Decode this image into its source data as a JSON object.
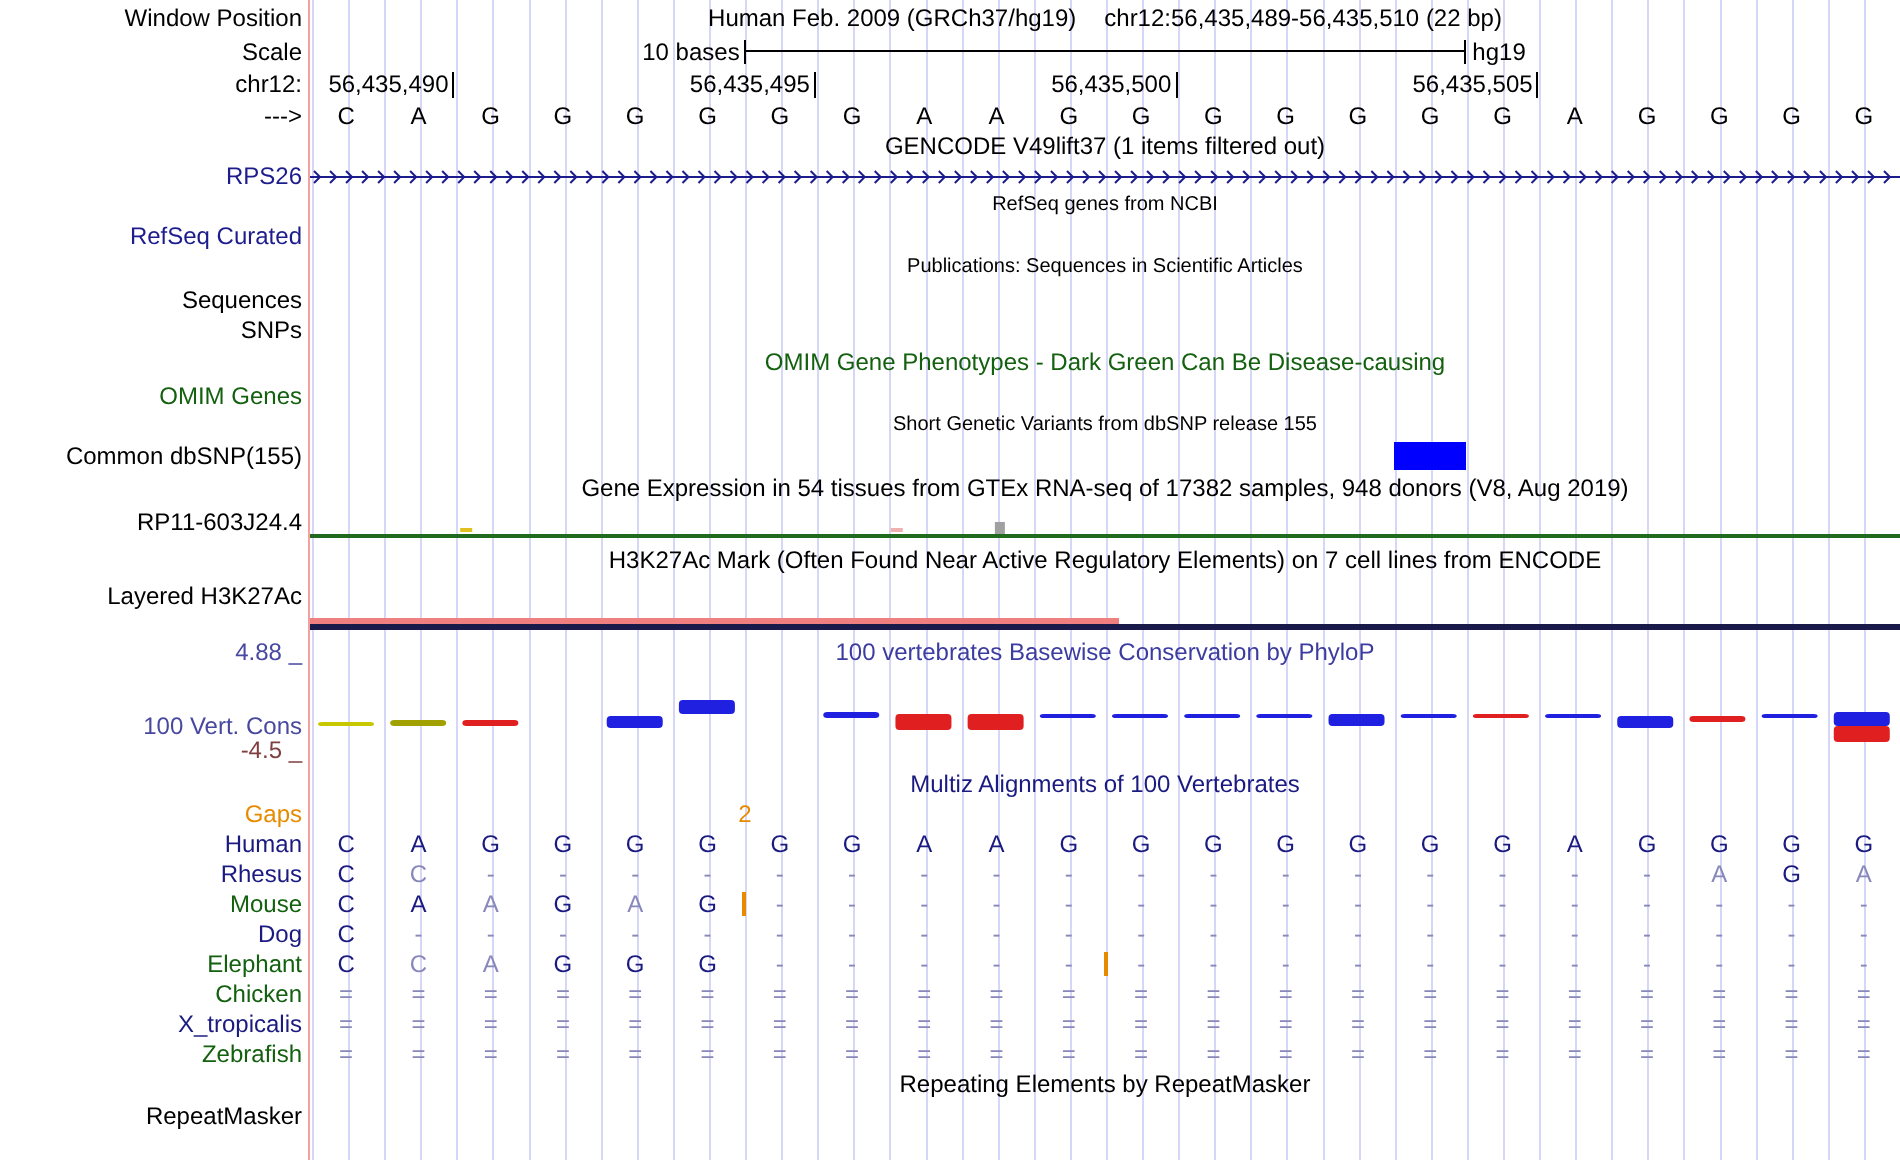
{
  "position": {
    "label": "Window Position",
    "assembly": "Human Feb. 2009 (GRCh37/hg19)",
    "range": "chr12:56,435,489-56,435,510 (22 bp)"
  },
  "scale": {
    "label": "Scale",
    "length": "10 bases",
    "build": "hg19"
  },
  "ruler": {
    "label": "chr12:",
    "ticks": [
      "56,435,490",
      "56,435,495",
      "56,435,500",
      "56,435,505"
    ]
  },
  "sequence": {
    "label": "--->",
    "bases": [
      "C",
      "A",
      "G",
      "G",
      "G",
      "G",
      "G",
      "G",
      "A",
      "A",
      "G",
      "G",
      "G",
      "G",
      "G",
      "G",
      "G",
      "A",
      "G",
      "G",
      "G",
      "G"
    ]
  },
  "gencode": {
    "title": "GENCODE V49lift37 (1 items filtered out)",
    "gene": "RPS26"
  },
  "refseq": {
    "title": "RefSeq genes from NCBI",
    "label": "RefSeq Curated"
  },
  "publications": {
    "title": "Publications: Sequences in Scientific Articles",
    "labels": [
      "Sequences",
      "SNPs"
    ]
  },
  "omim": {
    "title": "OMIM Gene Phenotypes - Dark Green Can Be Disease-causing",
    "label": "OMIM Genes"
  },
  "dbsnp": {
    "title": "Short Genetic Variants from dbSNP release 155",
    "label": "Common dbSNP(155)"
  },
  "gtex": {
    "title": "Gene Expression in 54 tissues from GTEx RNA-seq of 17382 samples, 948 donors (V8, Aug 2019)",
    "gene": "RP11-603J24.4"
  },
  "h3k27ac": {
    "title": "H3K27Ac Mark (Often Found Near Active Regulatory Elements) on 7 cell lines from ENCODE",
    "label": "Layered H3K27Ac"
  },
  "conservation": {
    "title": "100 vertebrates Basewise Conservation by PhyloP",
    "max": "4.88 _",
    "label": "100 Vert. Cons",
    "min": "-4.5 _"
  },
  "multiz": {
    "title": "Multiz Alignments of 100 Vertebrates",
    "gaps_label": "Gaps",
    "species": [
      {
        "name": "Human",
        "color": "#1a1a80",
        "bases": [
          {
            "b": "C",
            "faded": false,
            "insert": false
          },
          {
            "b": "A",
            "faded": false,
            "insert": false
          },
          {
            "b": "G",
            "faded": false,
            "insert": false
          },
          {
            "b": "G",
            "faded": false,
            "insert": false
          },
          {
            "b": "G",
            "faded": false,
            "insert": false
          },
          {
            "b": "G",
            "faded": false,
            "insert": false
          },
          {
            "b": "G",
            "faded": false,
            "insert": false
          },
          {
            "b": "G",
            "faded": false,
            "insert": false
          },
          {
            "b": "A",
            "faded": false,
            "insert": false
          },
          {
            "b": "A",
            "faded": false,
            "insert": false
          },
          {
            "b": "G",
            "faded": false,
            "insert": false
          },
          {
            "b": "G",
            "faded": false,
            "insert": false
          },
          {
            "b": "G",
            "faded": false,
            "insert": false
          },
          {
            "b": "G",
            "faded": false,
            "insert": false
          },
          {
            "b": "G",
            "faded": false,
            "insert": false
          },
          {
            "b": "G",
            "faded": false,
            "insert": false
          },
          {
            "b": "G",
            "faded": false,
            "insert": false
          },
          {
            "b": "A",
            "faded": false,
            "insert": false
          },
          {
            "b": "G",
            "faded": false,
            "insert": false
          },
          {
            "b": "G",
            "faded": false,
            "insert": false
          },
          {
            "b": "G",
            "faded": false,
            "insert": false
          },
          {
            "b": "G",
            "faded": false,
            "insert": false
          }
        ]
      },
      {
        "name": "Rhesus",
        "color": "#1a1a80",
        "bases": [
          {
            "b": "C",
            "faded": false,
            "insert": false
          },
          {
            "b": "C",
            "faded": true,
            "insert": false
          },
          {
            "b": "-",
            "faded": true,
            "insert": false
          },
          {
            "b": "-",
            "faded": true,
            "insert": false
          },
          {
            "b": "-",
            "faded": true,
            "insert": false
          },
          {
            "b": "-",
            "faded": true,
            "insert": false
          },
          {
            "b": "-",
            "faded": true,
            "insert": false
          },
          {
            "b": "-",
            "faded": true,
            "insert": false
          },
          {
            "b": "-",
            "faded": true,
            "insert": false
          },
          {
            "b": "-",
            "faded": true,
            "insert": false
          },
          {
            "b": "-",
            "faded": true,
            "insert": false
          },
          {
            "b": "-",
            "faded": true,
            "insert": false
          },
          {
            "b": "-",
            "faded": true,
            "insert": false
          },
          {
            "b": "-",
            "faded": true,
            "insert": false
          },
          {
            "b": "-",
            "faded": true,
            "insert": false
          },
          {
            "b": "-",
            "faded": true,
            "insert": false
          },
          {
            "b": "-",
            "faded": true,
            "insert": false
          },
          {
            "b": "-",
            "faded": true,
            "insert": false
          },
          {
            "b": "-",
            "faded": true,
            "insert": false
          },
          {
            "b": "A",
            "faded": true,
            "insert": false
          },
          {
            "b": "G",
            "faded": false,
            "insert": false
          },
          {
            "b": "A",
            "faded": true,
            "insert": false
          }
        ]
      },
      {
        "name": "Mouse",
        "color": "#13600f",
        "bases": [
          {
            "b": "C",
            "faded": false,
            "insert": false
          },
          {
            "b": "A",
            "faded": false,
            "insert": false
          },
          {
            "b": "A",
            "faded": true,
            "insert": false
          },
          {
            "b": "G",
            "faded": false,
            "insert": false
          },
          {
            "b": "A",
            "faded": true,
            "insert": false
          },
          {
            "b": "G",
            "faded": false,
            "insert": true,
            "gap_count": "2"
          },
          {
            "b": "-",
            "faded": true,
            "insert": false
          },
          {
            "b": "-",
            "faded": true,
            "insert": false
          },
          {
            "b": "-",
            "faded": true,
            "insert": false
          },
          {
            "b": "-",
            "faded": true,
            "insert": false
          },
          {
            "b": "-",
            "faded": true,
            "insert": false
          },
          {
            "b": "-",
            "faded": true,
            "insert": false
          },
          {
            "b": "-",
            "faded": true,
            "insert": false
          },
          {
            "b": "-",
            "faded": true,
            "insert": false
          },
          {
            "b": "-",
            "faded": true,
            "insert": false
          },
          {
            "b": "-",
            "faded": true,
            "insert": false
          },
          {
            "b": "-",
            "faded": true,
            "insert": false
          },
          {
            "b": "-",
            "faded": true,
            "insert": false
          },
          {
            "b": "-",
            "faded": true,
            "insert": false
          },
          {
            "b": "-",
            "faded": true,
            "insert": false
          },
          {
            "b": "-",
            "faded": true,
            "insert": false
          },
          {
            "b": "-",
            "faded": true,
            "insert": false
          }
        ]
      },
      {
        "name": "Dog",
        "color": "#1a1a80",
        "bases": [
          {
            "b": "C",
            "faded": false,
            "insert": false
          },
          {
            "b": "-",
            "faded": true,
            "insert": false
          },
          {
            "b": "-",
            "faded": true,
            "insert": false
          },
          {
            "b": "-",
            "faded": true,
            "insert": false
          },
          {
            "b": "-",
            "faded": true,
            "insert": false
          },
          {
            "b": "-",
            "faded": true,
            "insert": false
          },
          {
            "b": "-",
            "faded": true,
            "insert": false
          },
          {
            "b": "-",
            "faded": true,
            "insert": false
          },
          {
            "b": "-",
            "faded": true,
            "insert": false
          },
          {
            "b": "-",
            "faded": true,
            "insert": false
          },
          {
            "b": "-",
            "faded": true,
            "insert": false
          },
          {
            "b": "-",
            "faded": true,
            "insert": false
          },
          {
            "b": "-",
            "faded": true,
            "insert": false
          },
          {
            "b": "-",
            "faded": true,
            "insert": false
          },
          {
            "b": "-",
            "faded": true,
            "insert": false
          },
          {
            "b": "-",
            "faded": true,
            "insert": false
          },
          {
            "b": "-",
            "faded": true,
            "insert": false
          },
          {
            "b": "-",
            "faded": true,
            "insert": false
          },
          {
            "b": "-",
            "faded": true,
            "insert": false
          },
          {
            "b": "-",
            "faded": true,
            "insert": false
          },
          {
            "b": "-",
            "faded": true,
            "insert": false
          },
          {
            "b": "-",
            "faded": true,
            "insert": false
          }
        ]
      },
      {
        "name": "Elephant",
        "color": "#13600f",
        "bases": [
          {
            "b": "C",
            "faded": false,
            "insert": false
          },
          {
            "b": "C",
            "faded": true,
            "insert": false
          },
          {
            "b": "A",
            "faded": true,
            "insert": false
          },
          {
            "b": "G",
            "faded": false,
            "insert": false
          },
          {
            "b": "G",
            "faded": false,
            "insert": false
          },
          {
            "b": "G",
            "faded": false,
            "insert": false
          },
          {
            "b": "-",
            "faded": true,
            "insert": false
          },
          {
            "b": "-",
            "faded": true,
            "insert": false
          },
          {
            "b": "-",
            "faded": true,
            "insert": false
          },
          {
            "b": "-",
            "faded": true,
            "insert": false
          },
          {
            "b": "-",
            "faded": true,
            "insert": true
          },
          {
            "b": "-",
            "faded": true,
            "insert": false
          },
          {
            "b": "-",
            "faded": true,
            "insert": false
          },
          {
            "b": "-",
            "faded": true,
            "insert": false
          },
          {
            "b": "-",
            "faded": true,
            "insert": false
          },
          {
            "b": "-",
            "faded": true,
            "insert": false
          },
          {
            "b": "-",
            "faded": true,
            "insert": false
          },
          {
            "b": "-",
            "faded": true,
            "insert": false
          },
          {
            "b": "-",
            "faded": true,
            "insert": false
          },
          {
            "b": "-",
            "faded": true,
            "insert": false
          },
          {
            "b": "-",
            "faded": true,
            "insert": false
          },
          {
            "b": "-",
            "faded": true,
            "insert": false
          }
        ]
      },
      {
        "name": "Chicken",
        "color": "#13600f",
        "bases": [
          {
            "b": "=",
            "faded": true,
            "insert": false
          },
          {
            "b": "=",
            "faded": true,
            "insert": false
          },
          {
            "b": "=",
            "faded": true,
            "insert": false
          },
          {
            "b": "=",
            "faded": true,
            "insert": false
          },
          {
            "b": "=",
            "faded": true,
            "insert": false
          },
          {
            "b": "=",
            "faded": true,
            "insert": false
          },
          {
            "b": "=",
            "faded": true,
            "insert": false
          },
          {
            "b": "=",
            "faded": true,
            "insert": false
          },
          {
            "b": "=",
            "faded": true,
            "insert": false
          },
          {
            "b": "=",
            "faded": true,
            "insert": false
          },
          {
            "b": "=",
            "faded": true,
            "insert": false
          },
          {
            "b": "=",
            "faded": true,
            "insert": false
          },
          {
            "b": "=",
            "faded": true,
            "insert": false
          },
          {
            "b": "=",
            "faded": true,
            "insert": false
          },
          {
            "b": "=",
            "faded": true,
            "insert": false
          },
          {
            "b": "=",
            "faded": true,
            "insert": false
          },
          {
            "b": "=",
            "faded": true,
            "insert": false
          },
          {
            "b": "=",
            "faded": true,
            "insert": false
          },
          {
            "b": "=",
            "faded": true,
            "insert": false
          },
          {
            "b": "=",
            "faded": true,
            "insert": false
          },
          {
            "b": "=",
            "faded": true,
            "insert": false
          },
          {
            "b": "=",
            "faded": true,
            "insert": false
          }
        ]
      },
      {
        "name": "X_tropicalis",
        "color": "#1a1a80",
        "bases": [
          {
            "b": "=",
            "faded": true,
            "insert": false
          },
          {
            "b": "=",
            "faded": true,
            "insert": false
          },
          {
            "b": "=",
            "faded": true,
            "insert": false
          },
          {
            "b": "=",
            "faded": true,
            "insert": false
          },
          {
            "b": "=",
            "faded": true,
            "insert": false
          },
          {
            "b": "=",
            "faded": true,
            "insert": false
          },
          {
            "b": "=",
            "faded": true,
            "insert": false
          },
          {
            "b": "=",
            "faded": true,
            "insert": false
          },
          {
            "b": "=",
            "faded": true,
            "insert": false
          },
          {
            "b": "=",
            "faded": true,
            "insert": false
          },
          {
            "b": "=",
            "faded": true,
            "insert": false
          },
          {
            "b": "=",
            "faded": true,
            "insert": false
          },
          {
            "b": "=",
            "faded": true,
            "insert": false
          },
          {
            "b": "=",
            "faded": true,
            "insert": false
          },
          {
            "b": "=",
            "faded": true,
            "insert": false
          },
          {
            "b": "=",
            "faded": true,
            "insert": false
          },
          {
            "b": "=",
            "faded": true,
            "insert": false
          },
          {
            "b": "=",
            "faded": true,
            "insert": false
          },
          {
            "b": "=",
            "faded": true,
            "insert": false
          },
          {
            "b": "=",
            "faded": true,
            "insert": false
          },
          {
            "b": "=",
            "faded": true,
            "insert": false
          },
          {
            "b": "=",
            "faded": true,
            "insert": false
          }
        ]
      },
      {
        "name": "Zebrafish",
        "color": "#13600f",
        "bases": [
          {
            "b": "=",
            "faded": true,
            "insert": false
          },
          {
            "b": "=",
            "faded": true,
            "insert": false
          },
          {
            "b": "=",
            "faded": true,
            "insert": false
          },
          {
            "b": "=",
            "faded": true,
            "insert": false
          },
          {
            "b": "=",
            "faded": true,
            "insert": false
          },
          {
            "b": "=",
            "faded": true,
            "insert": false
          },
          {
            "b": "=",
            "faded": true,
            "insert": false
          },
          {
            "b": "=",
            "faded": true,
            "insert": false
          },
          {
            "b": "=",
            "faded": true,
            "insert": false
          },
          {
            "b": "=",
            "faded": true,
            "insert": false
          },
          {
            "b": "=",
            "faded": true,
            "insert": false
          },
          {
            "b": "=",
            "faded": true,
            "insert": false
          },
          {
            "b": "=",
            "faded": true,
            "insert": false
          },
          {
            "b": "=",
            "faded": true,
            "insert": false
          },
          {
            "b": "=",
            "faded": true,
            "insert": false
          },
          {
            "b": "=",
            "faded": true,
            "insert": false
          },
          {
            "b": "=",
            "faded": true,
            "insert": false
          },
          {
            "b": "=",
            "faded": true,
            "insert": false
          },
          {
            "b": "=",
            "faded": true,
            "insert": false
          },
          {
            "b": "=",
            "faded": true,
            "insert": false
          },
          {
            "b": "=",
            "faded": true,
            "insert": false
          },
          {
            "b": "=",
            "faded": true,
            "insert": false
          }
        ]
      }
    ]
  },
  "repeatmasker": {
    "title": "Repeating Elements by RepeatMasker",
    "label": "RepeatMasker"
  }
}
